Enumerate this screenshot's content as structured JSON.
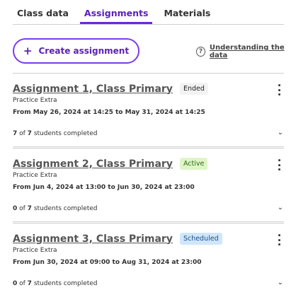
{
  "tabs": [
    {
      "label": "Class data"
    },
    {
      "label": "Assignments"
    },
    {
      "label": "Materials"
    }
  ],
  "actions": {
    "create_label": "Create assignment",
    "help_label": "Understanding the data",
    "create_icon": "plus-icon",
    "help_icon": "question-circle-icon"
  },
  "assignments": [
    {
      "title": "Assignment 1, Class Primary",
      "status": "Ended",
      "subtitle": "Practice Extra",
      "dates": "From May 26, 2024 at 14:25 to May 31, 2024 at 14:25",
      "completed": "7",
      "total": "7",
      "completed_suffix": "students completed"
    },
    {
      "title": "Assignment 2, Class Primary",
      "status": "Active",
      "subtitle": "Practice Extra",
      "dates": "From Jun 4, 2024 at 13:00 to Jun 30, 2024 at 23:00",
      "completed": "0",
      "total": "7",
      "completed_suffix": "students completed"
    },
    {
      "title": "Assignment 3, Class Primary",
      "status": "Scheduled",
      "subtitle": "Practice Extra",
      "dates": "From Jun 30, 2024 at 09:00 to Aug 31, 2024 at 23:00",
      "completed": "0",
      "total": "7",
      "completed_suffix": "students completed"
    }
  ],
  "colors": {
    "accent": "#6d28d9",
    "ended_badge": "#f2f2f2",
    "active_badge": "#dff5c8",
    "scheduled_badge": "#cfe6fb"
  }
}
